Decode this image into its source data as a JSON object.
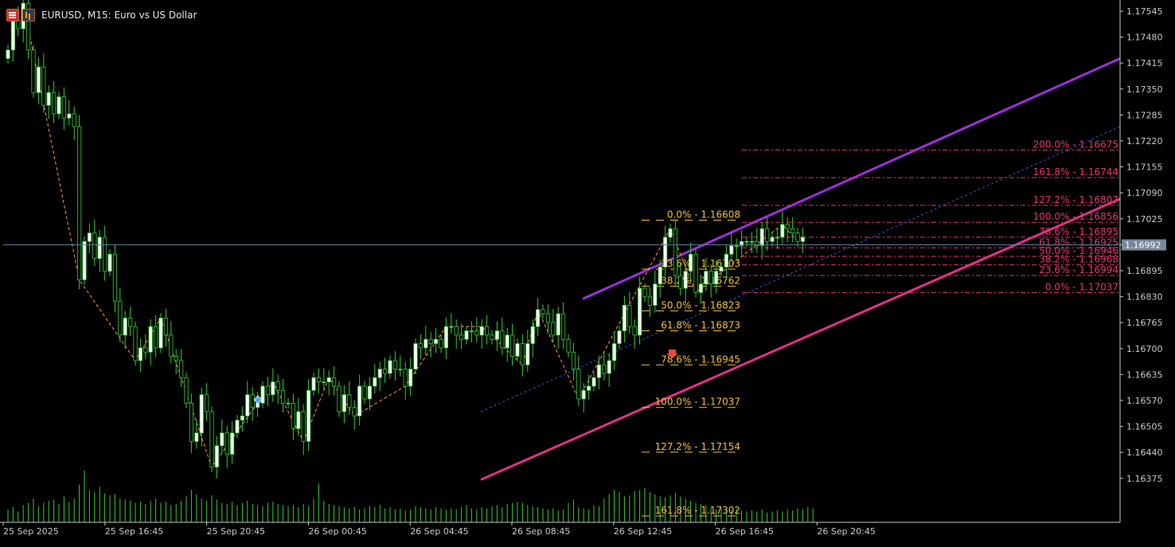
{
  "window": {
    "title": "EURUSD, M15:  Euro vs US Dollar",
    "current_price_label": "1.16992"
  },
  "icons": {
    "menu": "list-icon",
    "indicators": "chart-bars-icon",
    "sell_marker": "sell-arrow-icon",
    "buy_marker": "buy-arrow-icon"
  },
  "colors": {
    "background": "#000000",
    "bull_candle": "#ffffff",
    "bear_candle": "#000000",
    "wick": "#33cc33",
    "volume": "#33cc33",
    "zigzag": "#ff9933",
    "channel_upper": "#9b30d9",
    "channel_lower": "#e0308a",
    "fib_left": "#f2c12e",
    "fib_right": "#e8336d",
    "price_line": "#5c7d99",
    "axis": "#c8c8c8"
  },
  "chart_data": {
    "type": "candlestick",
    "symbol": "EURUSD",
    "timeframe": "M15",
    "y_ticks": [
      "1.17545",
      "1.17480",
      "1.17415",
      "1.17350",
      "1.17285",
      "1.17220",
      "1.17155",
      "1.17090",
      "1.17025",
      "1.16960",
      "1.16895",
      "1.16830",
      "1.16765",
      "1.16700",
      "1.16635",
      "1.16570",
      "1.16505",
      "1.16440",
      "1.16375"
    ],
    "x_ticks": [
      "25 Sep 2025",
      "25 Sep 16:45",
      "25 Sep 20:45",
      "26 Sep 00:45",
      "26 Sep 04:45",
      "26 Sep 08:45",
      "26 Sep 12:45",
      "26 Sep 16:45",
      "26 Sep 20:45"
    ],
    "ylim": [
      1.1634,
      1.1756
    ],
    "current_price": 1.16992,
    "closes": [
      1.1745,
      1.1752,
      1.175,
      1.1756,
      1.1745,
      1.1735,
      1.1741,
      1.1732,
      1.1735,
      1.173,
      1.1734,
      1.1729,
      1.173,
      1.1727,
      1.1691,
      1.17,
      1.1702,
      1.1696,
      1.1701,
      1.1693,
      1.1697,
      1.1686,
      1.1678,
      1.1682,
      1.168,
      1.1672,
      1.1675,
      1.1674,
      1.168,
      1.1675,
      1.1682,
      1.1678,
      1.1673,
      1.1672,
      1.1668,
      1.1662,
      1.1653,
      1.1655,
      1.1664,
      1.166,
      1.1647,
      1.1652,
      1.1655,
      1.165,
      1.1655,
      1.1658,
      1.1659,
      1.1664,
      1.1661,
      1.1662,
      1.1666,
      1.1664,
      1.1667,
      1.1665,
      1.1662,
      1.1662,
      1.1656,
      1.166,
      1.1653,
      1.1665,
      1.1668,
      1.1667,
      1.1667,
      1.1668,
      1.1666,
      1.166,
      1.1664,
      1.1661,
      1.1659,
      1.1666,
      1.1663,
      1.1666,
      1.1668,
      1.167,
      1.1669,
      1.1672,
      1.167,
      1.167,
      1.1666,
      1.167,
      1.1676,
      1.1675,
      1.1677,
      1.1676,
      1.1677,
      1.1675,
      1.168,
      1.168,
      1.1678,
      1.1677,
      1.1679,
      1.1679,
      1.1678,
      1.168,
      1.1678,
      1.1677,
      1.1679,
      1.1675,
      1.1678,
      1.1673,
      1.1676,
      1.1671,
      1.1676,
      1.168,
      1.1684,
      1.1683,
      1.1681,
      1.1678,
      1.1683,
      1.1677,
      1.1674,
      1.167,
      1.1663,
      1.1665,
      1.1666,
      1.1668,
      1.1671,
      1.1669,
      1.1672,
      1.1676,
      1.1679,
      1.1685,
      1.168,
      1.1678,
      1.1689,
      1.1687,
      1.1685,
      1.169,
      1.1694,
      1.1701,
      1.1703,
      1.1692,
      1.1689,
      1.1693,
      1.1697,
      1.1688,
      1.169,
      1.1693,
      1.169,
      1.1693,
      1.1694,
      1.1697,
      1.1699,
      1.1699,
      1.17,
      1.17,
      1.17,
      1.1699,
      1.1703,
      1.17,
      1.1701,
      1.1701,
      1.1704,
      1.1703,
      1.1702,
      1.17,
      1.1701
    ],
    "volumes": [
      12,
      14,
      10,
      16,
      18,
      22,
      15,
      18,
      20,
      21,
      17,
      24,
      19,
      22,
      35,
      48,
      30,
      28,
      33,
      27,
      25,
      26,
      22,
      21,
      20,
      18,
      19,
      17,
      20,
      22,
      18,
      19,
      16,
      17,
      20,
      24,
      30,
      26,
      22,
      20,
      25,
      21,
      18,
      17,
      19,
      16,
      18,
      20,
      17,
      16,
      15,
      18,
      19,
      17,
      16,
      15,
      16,
      14,
      17,
      15,
      22,
      36,
      20,
      17,
      16,
      15,
      14,
      13,
      14,
      12,
      13,
      15,
      14,
      16,
      13,
      14,
      12,
      13,
      11,
      12,
      15,
      14,
      13,
      12,
      14,
      13,
      12,
      13,
      12,
      14,
      16,
      13,
      12,
      14,
      13,
      15,
      16,
      14,
      17,
      18,
      19,
      18,
      16,
      15,
      14,
      13,
      12,
      13,
      11,
      12,
      18,
      21,
      14,
      13,
      12,
      16,
      15,
      22,
      26,
      30,
      28,
      24,
      25,
      29,
      30,
      32,
      28,
      26,
      24,
      23,
      25,
      27,
      24,
      22,
      20,
      18,
      17,
      16,
      14,
      12,
      13,
      11,
      12,
      13,
      11,
      10,
      11,
      10,
      12,
      9,
      10,
      11,
      10,
      12,
      11,
      13,
      12,
      14,
      13
    ],
    "channel": {
      "upper": [
        [
          1.16865,
          1.1743
        ]
      ],
      "lower": [
        [
          1.1644,
          1.171
        ]
      ],
      "mid_dotted": [
        [
          1.166,
          1.1727
        ]
      ]
    },
    "fibonacci_left": [
      {
        "text": "0.0% - 1.16608",
        "price": 1.1705
      },
      {
        "text": "23.6% - 1.16703",
        "price": 1.16935
      },
      {
        "text": "38.2% - 1.16762",
        "price": 1.16895
      },
      {
        "text": "50.0% - 1.16823",
        "price": 1.16837
      },
      {
        "text": "61.8% - 1.16873",
        "price": 1.1679
      },
      {
        "text": "78.6% - 1.16945",
        "price": 1.1671
      },
      {
        "text": "100.0% - 1.17037",
        "price": 1.1661
      },
      {
        "text": "127.2% - 1.17154",
        "price": 1.16505
      },
      {
        "text": "161.8% - 1.17302",
        "price": 1.16355
      }
    ],
    "fibonacci_right": [
      {
        "text": "200.0% - 1.16675",
        "price": 1.17215
      },
      {
        "text": "161.8% - 1.16744",
        "price": 1.1715
      },
      {
        "text": "127.2% - 1.16807",
        "price": 1.17085
      },
      {
        "text": "100.0% - 1.16856",
        "price": 1.17045
      },
      {
        "text": "78.6% - 1.16895",
        "price": 1.1701
      },
      {
        "text": "61.8% - 1.16925",
        "price": 1.16985
      },
      {
        "text": "50.0% - 1.16946",
        "price": 1.16965
      },
      {
        "text": "38.2% - 1.16968",
        "price": 1.16945
      },
      {
        "text": "23.6% - 1.16994",
        "price": 1.1692
      },
      {
        "text": "0.0% - 1.17037",
        "price": 1.1688
      }
    ]
  }
}
